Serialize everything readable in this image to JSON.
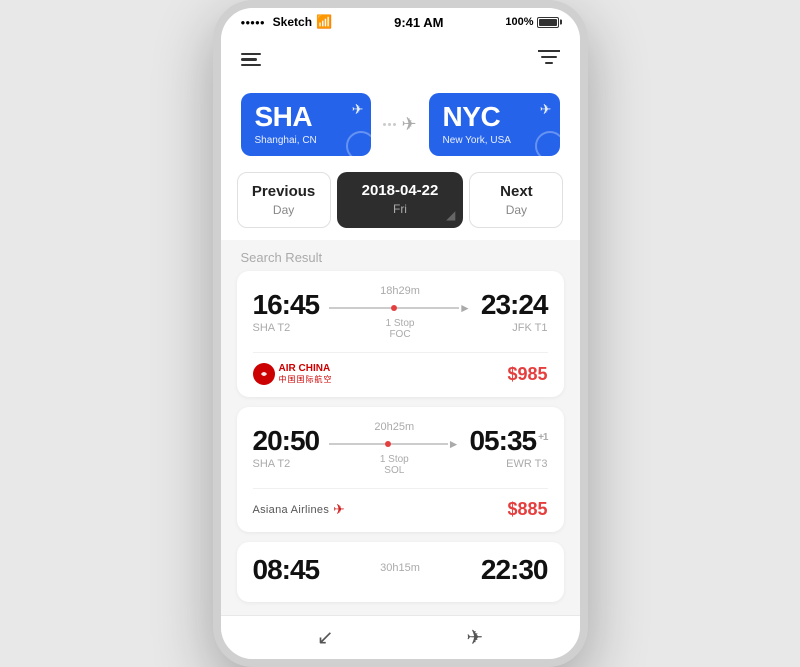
{
  "statusBar": {
    "dots": [
      "●",
      "●",
      "●",
      "●",
      "●"
    ],
    "carrier": "Sketch",
    "wifi": "wifi",
    "time": "9:41 AM",
    "battery": "100%"
  },
  "header": {
    "menuLabel": "menu",
    "filterLabel": "filter"
  },
  "route": {
    "from": {
      "code": "SHA",
      "city": "Shanghai, CN"
    },
    "to": {
      "code": "NYC",
      "city": "New York, USA"
    }
  },
  "dateNav": {
    "prev": {
      "main": "Previous",
      "sub": "Day"
    },
    "current": {
      "date": "2018-04-22",
      "day": "Fri"
    },
    "next": {
      "main": "Next",
      "sub": "Day"
    }
  },
  "searchResultLabel": "Search Result",
  "flights": [
    {
      "depTime": "16:45",
      "depTerminal": "SHA T2",
      "duration": "18h29m",
      "stops": "1 Stop",
      "stopLocation": "FOC",
      "arrTime": "23:24",
      "arrTerminal": "JFK T1",
      "airline": "Air China",
      "price": "$985",
      "plusOne": false
    },
    {
      "depTime": "20:50",
      "depTerminal": "SHA T2",
      "duration": "20h25m",
      "stops": "1 Stop",
      "stopLocation": "SOL",
      "arrTime": "05:35",
      "arrTerminal": "EWR T3",
      "airline": "Asiana Airlines",
      "price": "$885",
      "plusOne": true
    }
  ],
  "partialFlight": {
    "depTime": "08:45",
    "duration": "30h15m",
    "arrTime": "22:30"
  },
  "bottomNav": {
    "backIcon": "↙",
    "planeIcon": "✈"
  }
}
